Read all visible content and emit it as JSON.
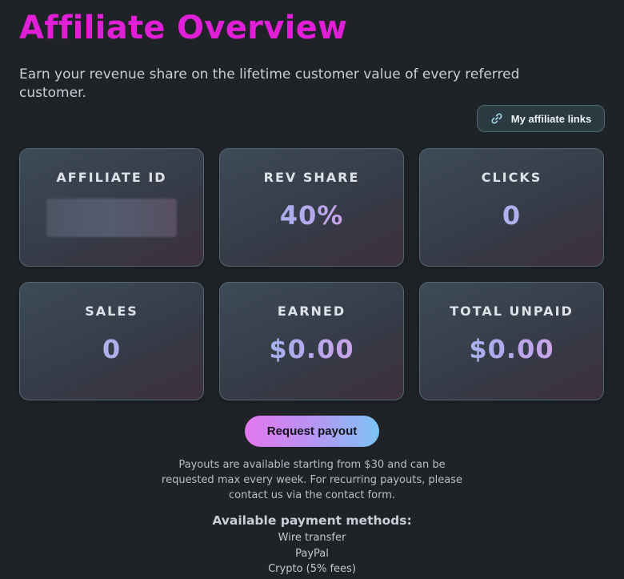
{
  "header": {
    "title": "Affiliate Overview",
    "subtitle": "Earn your revenue share on the lifetime customer value of every referred customer."
  },
  "toolbar": {
    "links_label": "My affiliate links",
    "links_icon": "link-icon"
  },
  "stats": {
    "affiliate_id": {
      "label": "AFFILIATE ID",
      "value_redacted": true
    },
    "rev_share": {
      "label": "REV SHARE",
      "value": "40%"
    },
    "clicks": {
      "label": "CLICKS",
      "value": "0"
    },
    "sales": {
      "label": "SALES",
      "value": "0"
    },
    "earned": {
      "label": "EARNED",
      "value": "$0.00"
    },
    "total_unpaid": {
      "label": "TOTAL UNPAID",
      "value": "$0.00"
    }
  },
  "payout": {
    "button_label": "Request payout",
    "note": "Payouts are available starting from $30 and can be requested max every week. For recurring payouts, please contact us via the contact form."
  },
  "payment_methods": {
    "heading": "Available payment methods:",
    "items": [
      "Wire transfer",
      "PayPal",
      "Crypto (5% fees)"
    ]
  },
  "colors": {
    "title": "#e11fd6",
    "background": "#1f2328",
    "card_border": "#536874",
    "payout_gradient_start": "#e377ee",
    "payout_gradient_end": "#7cc4f4"
  }
}
